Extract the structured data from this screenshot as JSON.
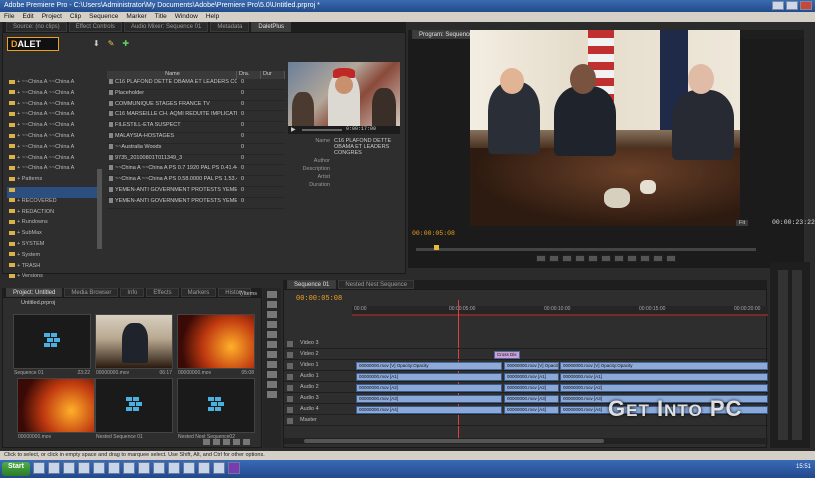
{
  "window": {
    "title": "Adobe Premiere Pro - C:\\Users\\Administrator\\My Documents\\Adobe\\Premiere Pro\\5.0\\Untitled.prproj *"
  },
  "menu": [
    "File",
    "Edit",
    "Project",
    "Clip",
    "Sequence",
    "Marker",
    "Title",
    "Window",
    "Help"
  ],
  "top_tabs": [
    {
      "label": "Source: (no clips)"
    },
    {
      "label": "Effect Controls"
    },
    {
      "label": "Audio Mixer: Sequence 01"
    },
    {
      "label": "Metadata"
    },
    {
      "label": "DaletPlus"
    }
  ],
  "dalet": {
    "logo_d": "D",
    "logo_rest": "ALET",
    "tree": [
      "+ ~~China A ~~China A",
      "+ ~~China A ~~China A",
      "+ ~~China A ~~China A",
      "+ ~~China A ~~China A",
      "+ ~~China A ~~China A",
      "+ ~~China A ~~China A",
      "+ ~~China A ~~China A",
      "+ ~~China A ~~China A",
      "+ ~~China A ~~China A",
      "+ Patterns",
      "",
      "+ RECOVERED",
      "+ REDACTION",
      "+ Rundowns",
      "+ SubMax",
      "+ SYSTEM",
      "+ System",
      "+ TRASH",
      "+ Versions"
    ],
    "columns": [
      "Name",
      "Dra.",
      "Dur"
    ],
    "rows": [
      {
        "name": "C16 PLAFOND DETTE OBAMA ET LEADERS CONG",
        "v": "0"
      },
      {
        "name": "Placeholder",
        "v": "0"
      },
      {
        "name": "COMMUNIQUE STAGES FRANCE TV",
        "v": "0"
      },
      {
        "name": "C16 MARSEILLE CH. AQMI REDUITE IMPLICATION DAI",
        "v": "0"
      },
      {
        "name": "FILESTILL-ETA SUSPECT",
        "v": "0"
      },
      {
        "name": "MALAYSIA-HOSTAGES",
        "v": "0"
      },
      {
        "name": "~~Australia Woods",
        "v": "0"
      },
      {
        "name": "9735_20100801T011349_3",
        "v": "0"
      },
      {
        "name": "~~China A ~~China A PS 0.7 1920 PAL PS 0.41.44",
        "v": "0"
      },
      {
        "name": "~~China A ~~China A PS 0.58.0000 PAL PS 1.53.40",
        "v": "0"
      },
      {
        "name": "YEMEN-ANTI GOVERNMENT PROTESTS YEMEN-A",
        "v": "0"
      },
      {
        "name": "YEMEN-ANTI GOVERNMENT PROTESTS YEMEN-A",
        "v": "0"
      }
    ],
    "preview_tc": "0:00:17:00",
    "meta": [
      {
        "k": "Name",
        "v": "C16 PLAFOND DETTE OBAMA ET LEADERS CONGRES"
      },
      {
        "k": "Author",
        "v": ""
      },
      {
        "k": "Description",
        "v": ""
      },
      {
        "k": "Artist",
        "v": ""
      },
      {
        "k": "Duration",
        "v": ""
      }
    ]
  },
  "program": {
    "tab": "Program: Sequence 01",
    "tc_left": "00:00:05:08",
    "tc_right": "00:00:23:22",
    "fit": "Fit"
  },
  "project": {
    "tabs": [
      "Project: Untitled",
      "Media Browser",
      "Info",
      "Effects",
      "Markers",
      "History"
    ],
    "name": "Untitled.prproj",
    "items_count": "7 Items",
    "clips": [
      {
        "name": "Sequence 01",
        "dur": "23:22",
        "kind": "seq"
      },
      {
        "name": "00000000.mov",
        "dur": "06:17",
        "kind": "obama"
      },
      {
        "name": "00000000.mov",
        "dur": "05:08",
        "kind": "fire"
      },
      {
        "name": "00000000.mov",
        "dur": "",
        "kind": "fire"
      },
      {
        "name": "Nested Sequence 01",
        "dur": "",
        "kind": "seq"
      },
      {
        "name": "Nested Nest Sequence02",
        "dur": "",
        "kind": "seq"
      }
    ]
  },
  "timeline": {
    "tabs": [
      "Sequence 01",
      "Nested Nest Sequence"
    ],
    "tc": "00:00:05:08",
    "ruler": [
      "00:00",
      "00:00:05:00",
      "00:00:10:00",
      "00:00:15:00",
      "00:00:20:00"
    ],
    "tracks": [
      "Video 3",
      "Video 2",
      "Video 1",
      "Audio 1",
      "Audio 2",
      "Audio 3",
      "Audio 4",
      "Master"
    ],
    "v1_clips": [
      {
        "label": "00000000.mov [V] Opacity:Opacity"
      },
      {
        "label": "00000000.mov [V] Opacity"
      },
      {
        "label": "00000000.mov [V] Opacity:Opacity"
      }
    ],
    "v2_label": "Cross Dis",
    "a_clips": [
      "00000000.mov [A1]",
      "00000000.mov [A2]",
      "00000000.mov [A3]",
      "00000000.mov [A4]"
    ]
  },
  "status": "Click to select, or click in empty space and drag to marquee select. Use Shift, Alt, and Ctrl for other options.",
  "taskbar": {
    "start": "Start",
    "clock": "15:51"
  },
  "watermark": {
    "g": "G",
    "et": "ET",
    "i": "I",
    "nto": "NTO",
    "pc": "PC"
  }
}
